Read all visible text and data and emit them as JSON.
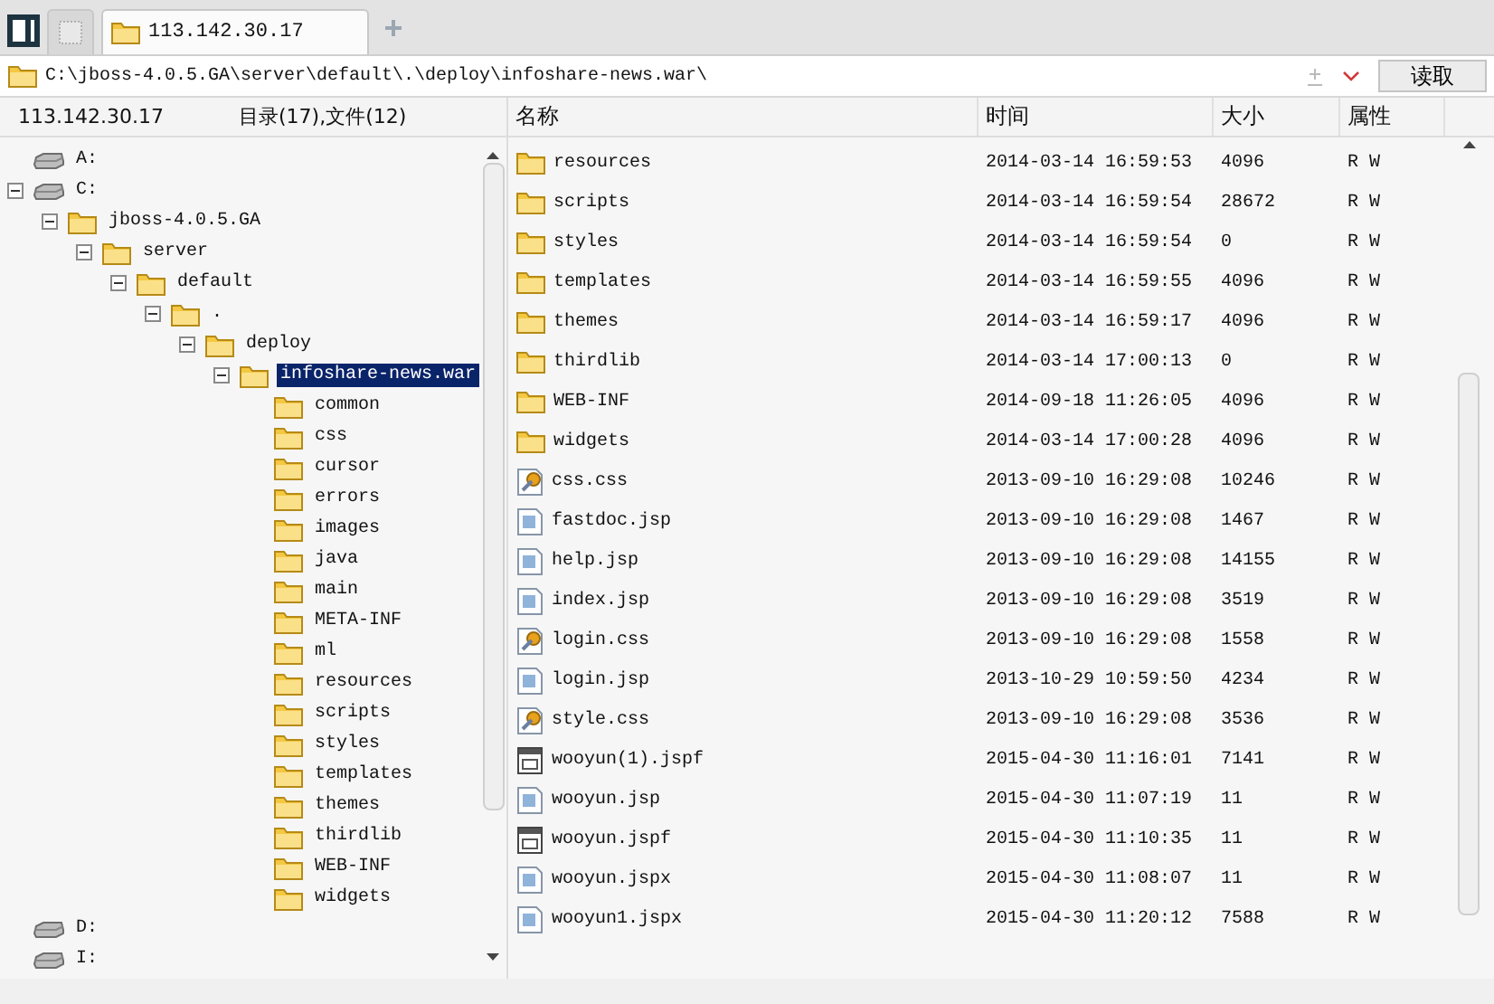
{
  "tabs": [
    {
      "kind": "blank",
      "selected": false
    },
    {
      "kind": "folder",
      "label": "113.142.30.17",
      "selected": true
    }
  ],
  "address": {
    "path": "C:\\jboss-4.0.5.GA\\server\\default\\.\\deploy\\infoshare-news.war\\",
    "button": "读取"
  },
  "tree_header": {
    "host": "113.142.30.17",
    "summary": "目录(17),文件(12)"
  },
  "tree": [
    {
      "kind": "drive",
      "label": "A:",
      "selected": false
    },
    {
      "kind": "drive",
      "label": "C:",
      "selected": false,
      "expanded": true,
      "children": [
        {
          "kind": "folder",
          "label": "jboss-4.0.5.GA",
          "selected": false,
          "expanded": true,
          "children": [
            {
              "kind": "folder",
              "label": "server",
              "selected": false,
              "expanded": true,
              "children": [
                {
                  "kind": "folder",
                  "label": "default",
                  "selected": false,
                  "expanded": true,
                  "children": [
                    {
                      "kind": "folder",
                      "label": ".",
                      "selected": false,
                      "expanded": true,
                      "children": [
                        {
                          "kind": "folder",
                          "label": "deploy",
                          "selected": false,
                          "expanded": true,
                          "children": [
                            {
                              "kind": "folder",
                              "label": "infoshare-news.war",
                              "selected": true,
                              "expanded": true,
                              "children": [
                                {
                                  "kind": "folder",
                                  "label": "common",
                                  "selected": false
                                },
                                {
                                  "kind": "folder",
                                  "label": "css",
                                  "selected": false
                                },
                                {
                                  "kind": "folder",
                                  "label": "cursor",
                                  "selected": false
                                },
                                {
                                  "kind": "folder",
                                  "label": "errors",
                                  "selected": false
                                },
                                {
                                  "kind": "folder",
                                  "label": "images",
                                  "selected": false
                                },
                                {
                                  "kind": "folder",
                                  "label": "java",
                                  "selected": false
                                },
                                {
                                  "kind": "folder",
                                  "label": "main",
                                  "selected": false
                                },
                                {
                                  "kind": "folder",
                                  "label": "META-INF",
                                  "selected": false
                                },
                                {
                                  "kind": "folder",
                                  "label": "ml",
                                  "selected": false
                                },
                                {
                                  "kind": "folder",
                                  "label": "resources",
                                  "selected": false
                                },
                                {
                                  "kind": "folder",
                                  "label": "scripts",
                                  "selected": false
                                },
                                {
                                  "kind": "folder",
                                  "label": "styles",
                                  "selected": false
                                },
                                {
                                  "kind": "folder",
                                  "label": "templates",
                                  "selected": false
                                },
                                {
                                  "kind": "folder",
                                  "label": "themes",
                                  "selected": false
                                },
                                {
                                  "kind": "folder",
                                  "label": "thirdlib",
                                  "selected": false
                                },
                                {
                                  "kind": "folder",
                                  "label": "WEB-INF",
                                  "selected": false
                                },
                                {
                                  "kind": "folder",
                                  "label": "widgets",
                                  "selected": false
                                }
                              ]
                            }
                          ]
                        }
                      ]
                    }
                  ]
                }
              ]
            }
          ]
        }
      ]
    },
    {
      "kind": "drive",
      "label": "D:",
      "selected": false
    },
    {
      "kind": "drive",
      "label": "I:",
      "selected": false
    }
  ],
  "table": {
    "columns": [
      "名称",
      "时间",
      "大小",
      "属性"
    ],
    "rows": [
      {
        "kind": "folder",
        "name": "resources",
        "time": "2014-03-14 16:59:53",
        "size": "4096",
        "attr": "R W"
      },
      {
        "kind": "folder",
        "name": "scripts",
        "time": "2014-03-14 16:59:54",
        "size": "28672",
        "attr": "R W"
      },
      {
        "kind": "folder",
        "name": "styles",
        "time": "2014-03-14 16:59:54",
        "size": "0",
        "attr": "R W"
      },
      {
        "kind": "folder",
        "name": "templates",
        "time": "2014-03-14 16:59:55",
        "size": "4096",
        "attr": "R W"
      },
      {
        "kind": "folder",
        "name": "themes",
        "time": "2014-03-14 16:59:17",
        "size": "4096",
        "attr": "R W"
      },
      {
        "kind": "folder",
        "name": "thirdlib",
        "time": "2014-03-14 17:00:13",
        "size": "0",
        "attr": "R W"
      },
      {
        "kind": "folder",
        "name": "WEB-INF",
        "time": "2014-09-18 11:26:05",
        "size": "4096",
        "attr": "R W"
      },
      {
        "kind": "folder",
        "name": "widgets",
        "time": "2014-03-14 17:00:28",
        "size": "4096",
        "attr": "R W"
      },
      {
        "kind": "css",
        "name": "css.css",
        "time": "2013-09-10 16:29:08",
        "size": "10246",
        "attr": "R W"
      },
      {
        "kind": "jsp",
        "name": "fastdoc.jsp",
        "time": "2013-09-10 16:29:08",
        "size": "1467",
        "attr": "R W"
      },
      {
        "kind": "jsp",
        "name": "help.jsp",
        "time": "2013-09-10 16:29:08",
        "size": "14155",
        "attr": "R W"
      },
      {
        "kind": "jsp",
        "name": "index.jsp",
        "time": "2013-09-10 16:29:08",
        "size": "3519",
        "attr": "R W"
      },
      {
        "kind": "css",
        "name": "login.css",
        "time": "2013-09-10 16:29:08",
        "size": "1558",
        "attr": "R W"
      },
      {
        "kind": "jsp",
        "name": "login.jsp",
        "time": "2013-10-29 10:59:50",
        "size": "4234",
        "attr": "R W"
      },
      {
        "kind": "css",
        "name": "style.css",
        "time": "2013-09-10 16:29:08",
        "size": "3536",
        "attr": "R W"
      },
      {
        "kind": "jspf",
        "name": "wooyun(1).jspf",
        "time": "2015-04-30 11:16:01",
        "size": "7141",
        "attr": "R W"
      },
      {
        "kind": "jsp",
        "name": "wooyun.jsp",
        "time": "2015-04-30 11:07:19",
        "size": "11",
        "attr": "R W"
      },
      {
        "kind": "jspf",
        "name": "wooyun.jspf",
        "time": "2015-04-30 11:10:35",
        "size": "11",
        "attr": "R W"
      },
      {
        "kind": "jsp",
        "name": "wooyun.jspx",
        "time": "2015-04-30 11:08:07",
        "size": "11",
        "attr": "R W"
      },
      {
        "kind": "jsp",
        "name": "wooyun1.jspx",
        "time": "2015-04-30 11:20:12",
        "size": "7588",
        "attr": "R W"
      }
    ]
  }
}
